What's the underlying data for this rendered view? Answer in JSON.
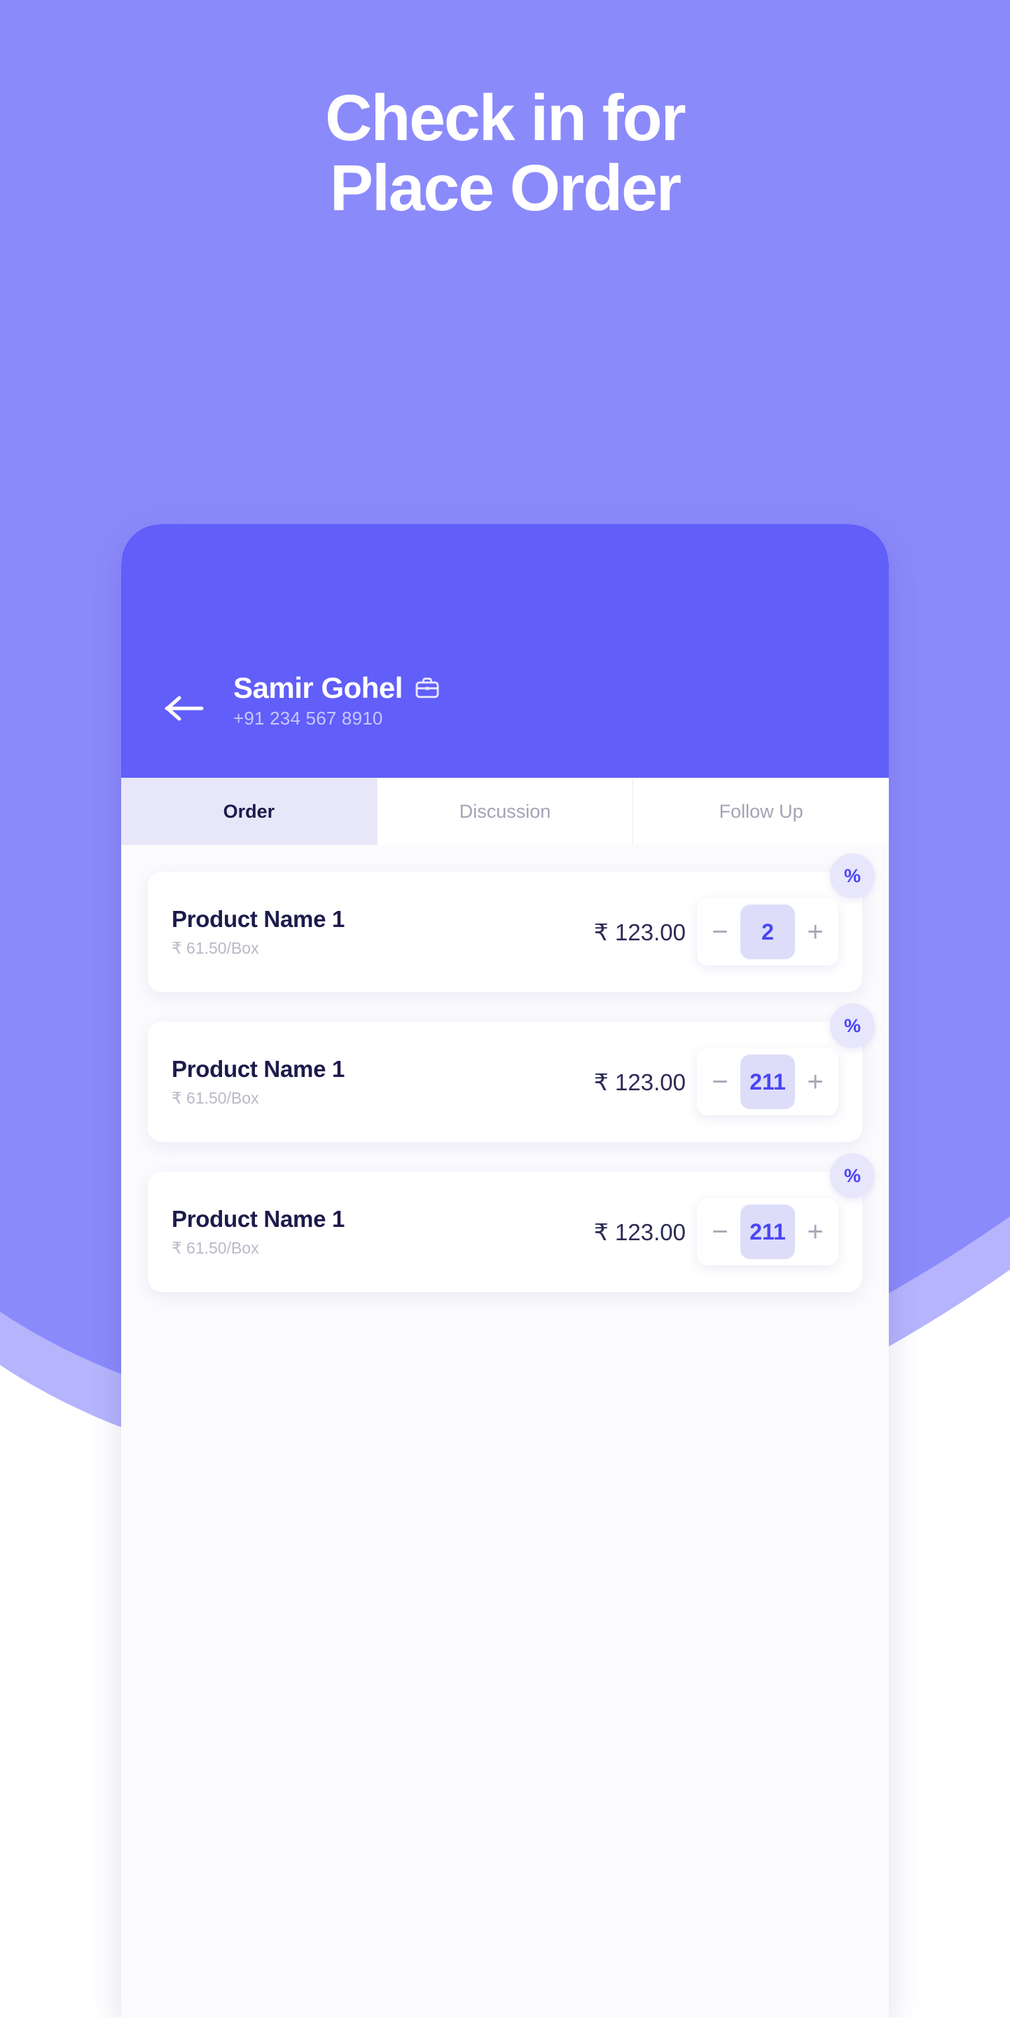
{
  "colors": {
    "bg_purple": "#8b8afb",
    "bg_purple_light": "#b5b4fc",
    "header_purple": "#615efa",
    "accent": "#4a45f5",
    "tab_active_bg": "#e8e7fa",
    "chip_bg": "#ddddfa",
    "text_dark": "#1d1b4b",
    "text_muted": "#b9b9c7"
  },
  "headline": {
    "line1": "Check in for",
    "line2": "Place Order"
  },
  "phone": {
    "header": {
      "back_icon": "arrow-left-icon",
      "contact_name": "Samir Gohel",
      "contact_badge_icon": "briefcase-icon",
      "contact_phone": "+91 234 567 8910"
    },
    "tabs": [
      {
        "label": "Order",
        "active": true
      },
      {
        "label": "Discussion",
        "active": false
      },
      {
        "label": "Follow Up",
        "active": false
      }
    ],
    "products": [
      {
        "name": "Product Name 1",
        "unit_price": "₹ 61.50/Box",
        "price": "₹ 123.00",
        "qty": "2",
        "decrement": "−",
        "increment": "+",
        "discount_badge": "%"
      },
      {
        "name": "Product Name 1",
        "unit_price": "₹ 61.50/Box",
        "price": "₹ 123.00",
        "qty": "211",
        "decrement": "−",
        "increment": "+",
        "discount_badge": "%"
      },
      {
        "name": "Product Name 1",
        "unit_price": "₹ 61.50/Box",
        "price": "₹ 123.00",
        "qty": "211",
        "decrement": "−",
        "increment": "+",
        "discount_badge": "%"
      }
    ]
  }
}
